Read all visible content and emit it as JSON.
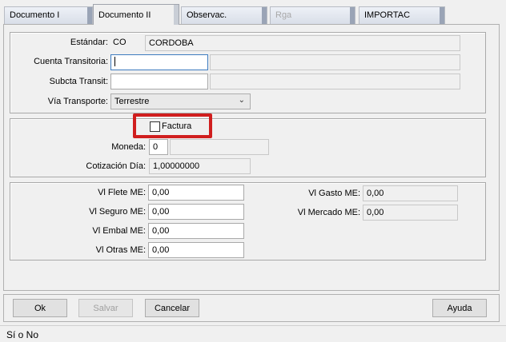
{
  "tabs": [
    {
      "label": "Documento  I",
      "state": "normal"
    },
    {
      "label": "Documento II",
      "state": "active"
    },
    {
      "label": "Observac.",
      "state": "normal"
    },
    {
      "label": "Rga",
      "state": "disabled"
    },
    {
      "label": "IMPORTAC",
      "state": "normal"
    }
  ],
  "general": {
    "estandar_label": "Estándar:",
    "estandar_code": "CO",
    "estandar_name": "CORDOBA",
    "cuenta_label": "Cuenta Transitoria:",
    "cuenta_value": "",
    "cuenta_desc": "",
    "subcta_label": "Subcta Transit:",
    "subcta_value": "",
    "subcta_desc": "",
    "via_label": "Vía Transporte:",
    "via_value": "Terrestre"
  },
  "factura": {
    "label": "Factura",
    "checked": false,
    "moneda_label": "Moneda:",
    "moneda_value": "0",
    "moneda_desc": "",
    "cotizacion_label": "Cotización Día:",
    "cotizacion_value": "1,00000000"
  },
  "valores": {
    "flete_label": "Vl Flete ME:",
    "flete_value": "0,00",
    "seguro_label": "Vl Seguro ME:",
    "seguro_value": "0,00",
    "embal_label": "Vl Embal ME:",
    "embal_value": "0,00",
    "otras_label": "Vl Otras ME:",
    "otras_value": "0,00",
    "gasto_label": "Vl Gasto ME:",
    "gasto_value": "0,00",
    "mercado_label": "Vl Mercado ME:",
    "mercado_value": "0,00"
  },
  "buttons": {
    "ok": "Ok",
    "salvar": "Salvar",
    "cancelar": "Cancelar",
    "ayuda": "Ayuda"
  },
  "status_text": "Sí o No",
  "colors": {
    "highlight": "#d01e1e",
    "focus_border": "#3d7bbf"
  }
}
